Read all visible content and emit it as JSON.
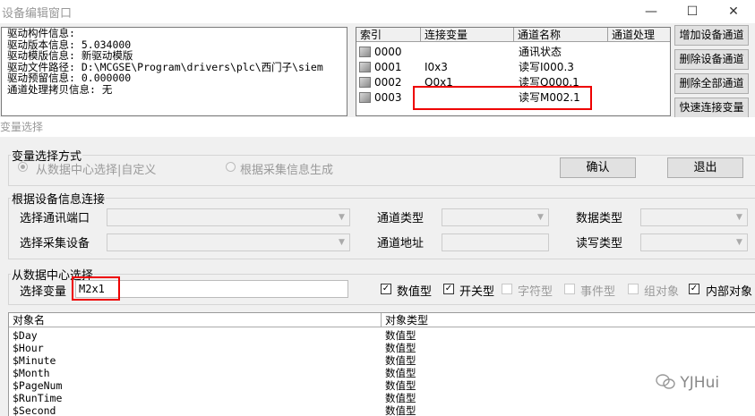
{
  "top_window": {
    "title": "设备编辑窗口",
    "controls": {
      "minimize": "—",
      "maximize": "☐",
      "close": "✕"
    },
    "driver_info": [
      "驱动构件信息:",
      "驱动版本信息: 5.034000",
      "驱动模版信息: 新驱动模版",
      "驱动文件路径: D:\\MCGSE\\Program\\drivers\\plc\\西门子\\siem",
      "驱动预留信息: 0.000000",
      "通道处理拷贝信息: 无"
    ],
    "channel_table": {
      "headers": [
        "索引",
        "连接变量",
        "通道名称",
        "通道处理"
      ],
      "rows": [
        {
          "index": "0000",
          "var": "",
          "name": "通讯状态",
          "proc": ""
        },
        {
          "index": "0001",
          "var": "I0x3",
          "name": "读写I000.3",
          "proc": ""
        },
        {
          "index": "0002",
          "var": "Q0x1",
          "name": "读写Q000.1",
          "proc": ""
        },
        {
          "index": "0003",
          "var": "",
          "name": "读写M002.1",
          "proc": ""
        }
      ]
    },
    "side_buttons": [
      "增加设备通道",
      "删除设备通道",
      "删除全部通道",
      "快速连接变量"
    ]
  },
  "var_window": {
    "title": "变量选择",
    "select_mode": {
      "legend": "变量选择方式",
      "option_center": "从数据中心选择|自定义",
      "option_collect": "根据采集信息生成",
      "ok": "确认",
      "exit": "退出"
    },
    "device_group": {
      "legend": "根据设备信息连接",
      "port_label": "选择通讯端口",
      "device_label": "选择采集设备",
      "channel_type_label": "通道类型",
      "channel_addr_label": "通道地址",
      "data_type_label": "数据类型",
      "rw_type_label": "读写类型"
    },
    "center_group": {
      "legend": "从数据中心选择",
      "select_label": "选择变量",
      "select_value": "M2x1",
      "checks": [
        {
          "label": "数值型",
          "checked": true,
          "enabled": true
        },
        {
          "label": "开关型",
          "checked": true,
          "enabled": true
        },
        {
          "label": "字符型",
          "checked": false,
          "enabled": false
        },
        {
          "label": "事件型",
          "checked": false,
          "enabled": false
        },
        {
          "label": "组对象",
          "checked": false,
          "enabled": false
        },
        {
          "label": "内部对象",
          "checked": true,
          "enabled": true
        }
      ]
    },
    "object_list": {
      "headers": [
        "对象名",
        "对象类型"
      ],
      "rows": [
        {
          "name": "$Day",
          "type": "数值型"
        },
        {
          "name": "$Hour",
          "type": "数值型"
        },
        {
          "name": "$Minute",
          "type": "数值型"
        },
        {
          "name": "$Month",
          "type": "数值型"
        },
        {
          "name": "$PageNum",
          "type": "数值型"
        },
        {
          "name": "$RunTime",
          "type": "数值型"
        },
        {
          "name": "$Second",
          "type": "数值型"
        }
      ]
    }
  },
  "watermark": "YJHui",
  "colors": {
    "highlight_box": "#e00000"
  }
}
